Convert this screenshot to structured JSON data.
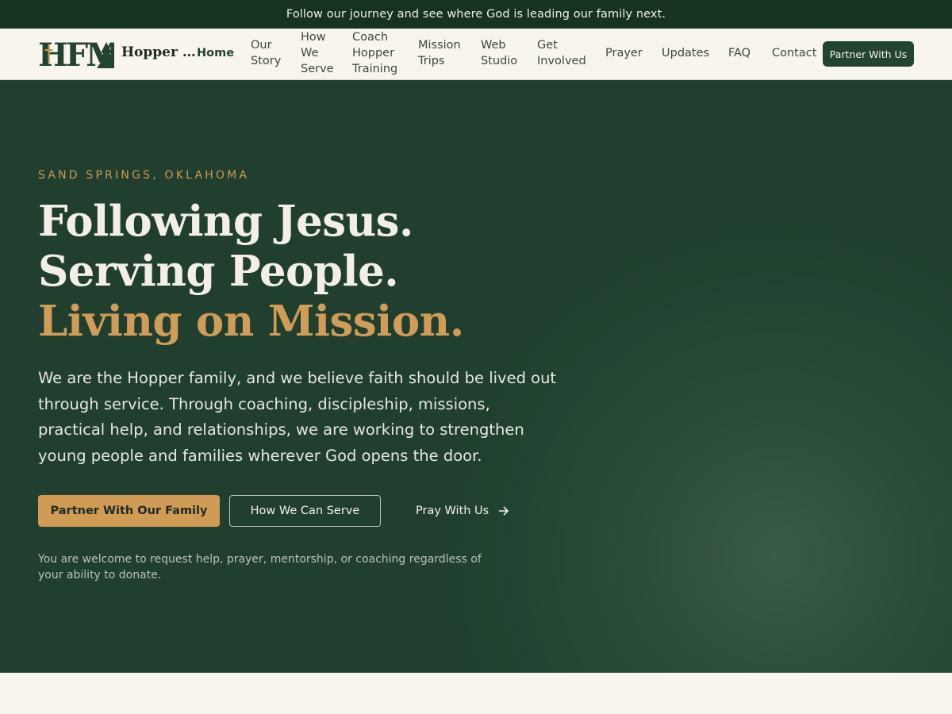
{
  "announcement": "Follow our journey and see where God is leading our family next.",
  "brand": {
    "logo_text": "HFM",
    "name": "Hopper …"
  },
  "nav": {
    "items": [
      {
        "label": "Home",
        "lines": [
          "Home"
        ],
        "active": true
      },
      {
        "label": "Our Story",
        "lines": [
          "Our",
          "Story"
        ]
      },
      {
        "label": "How We Serve",
        "lines": [
          "How",
          "We",
          "Serve"
        ]
      },
      {
        "label": "Coach Hopper Training",
        "lines": [
          "Coach",
          "Hopper",
          "Training"
        ]
      },
      {
        "label": "Mission Trips",
        "lines": [
          "Mission",
          "Trips"
        ]
      },
      {
        "label": "Web Studio",
        "lines": [
          "Web",
          "Studio"
        ]
      },
      {
        "label": "Get Involved",
        "lines": [
          "Get",
          "Involved"
        ]
      },
      {
        "label": "Prayer",
        "lines": [
          "Prayer"
        ]
      },
      {
        "label": "Updates",
        "lines": [
          "Updates"
        ]
      },
      {
        "label": "FAQ",
        "lines": [
          "FAQ"
        ]
      },
      {
        "label": "Contact",
        "lines": [
          "Contact"
        ]
      }
    ],
    "cta_label": "Partner With Us"
  },
  "hero": {
    "eyebrow": "SAND SPRINGS, OKLAHOMA",
    "headline_line1": "Following Jesus.",
    "headline_line2": "Serving People.",
    "headline_line3": "Living on Mission.",
    "lede": "We are the Hopper family, and we believe faith should be lived out through service. Through coaching, discipleship, missions, practical help, and relationships, we are working to strengthen young people and families wherever God opens the door.",
    "primary_button": "Partner With Our Family",
    "secondary_button": "How We Can Serve",
    "text_button": "Pray With Us",
    "text_button_icon": "arrow-right-icon",
    "fine_print": "You are welcome to request help, prayer, mentorship, or coaching regardless of your ability to donate."
  },
  "colors": {
    "announcement_bg": "#163221",
    "nav_bg": "#f8f4ee",
    "hero_bg": "#244633",
    "accent_gold": "#cf9b55",
    "cta_green": "#23442f"
  }
}
